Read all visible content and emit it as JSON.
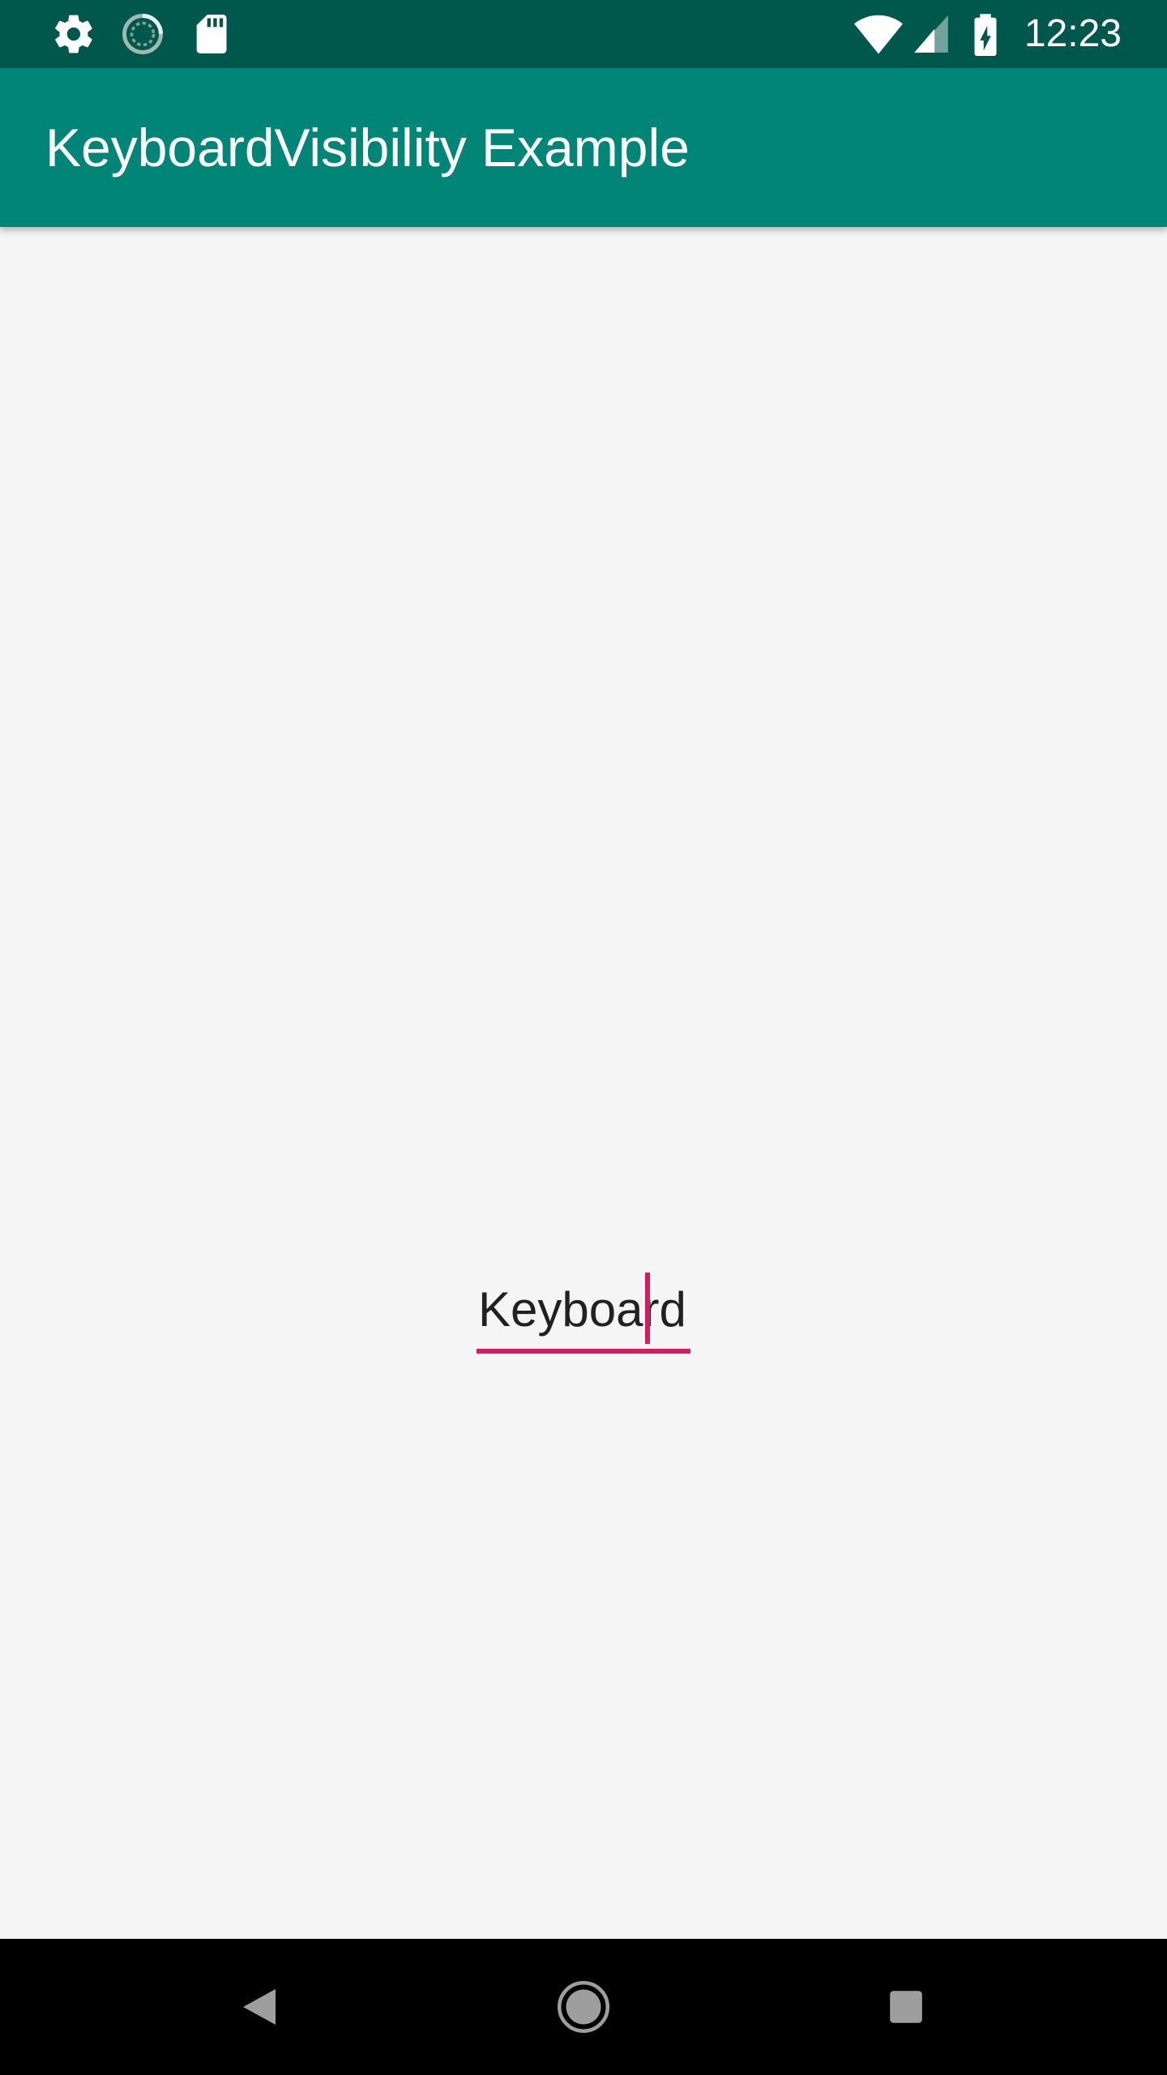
{
  "status_bar": {
    "time": "12:23",
    "icons": [
      "gear-icon",
      "sync-icon",
      "sd-card-icon",
      "wifi-icon",
      "cell-signal-icon",
      "battery-charging-icon"
    ],
    "background": "#00574b"
  },
  "app_bar": {
    "title": "KeyboardVisibility Example",
    "background": "#008577"
  },
  "edit_field": {
    "value": "Keyboard",
    "accent": "#d81b60"
  },
  "nav_bar": {
    "buttons": [
      "back-icon",
      "home-icon",
      "recents-icon"
    ]
  }
}
